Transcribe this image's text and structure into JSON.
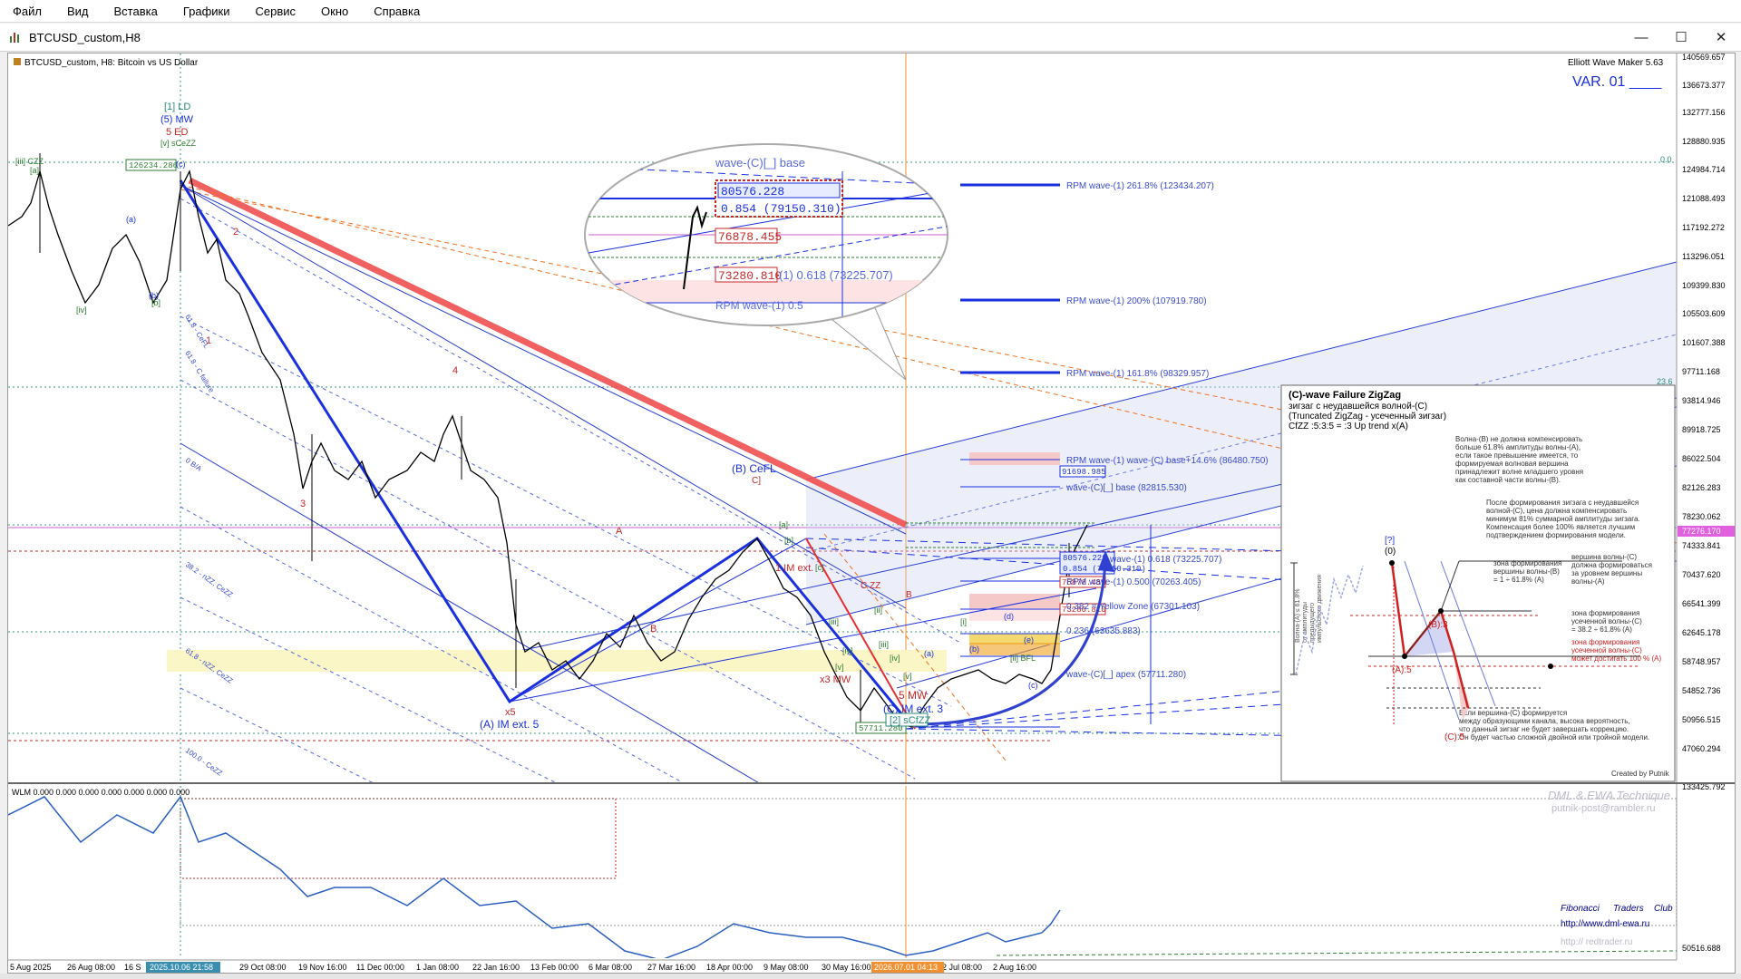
{
  "menu": [
    "Файл",
    "Вид",
    "Вставка",
    "Графики",
    "Сервис",
    "Окно",
    "Справка"
  ],
  "window": {
    "title": "BTCUSD_custom,H8",
    "minimize": "—",
    "maximize": "☐",
    "close": "✕"
  },
  "chart": {
    "symbol_label": "BTCUSD_custom, H8:  Bitcoin vs US Dollar",
    "indicator_name": "Elliott Wave Maker 5.63",
    "variant": "VAR. 01 ____",
    "current_price": "77276.170",
    "zero_label_top": "0.0",
    "level_236": "23.6"
  },
  "price_axis": [
    "140569.657",
    "136673.377",
    "132777.156",
    "128880.935",
    "124984.714",
    "121088.493",
    "117192.272",
    "113296.051",
    "109399.830",
    "105503.609",
    "101607.388",
    "97711.168",
    "93814.946",
    "89918.725",
    "86022.504",
    "82126.283",
    "78230.062",
    "74333.841",
    "70437.620",
    "66541.399",
    "62645.178",
    "58748.957",
    "54852.736",
    "50956.515",
    "47060.294",
    "133425.792",
    "50516.688"
  ],
  "time_axis": [
    "5 Aug 2025",
    "26 Aug 08:00",
    "16 S",
    "2025.10.06 21:58",
    "29 Oct 08:00",
    "19 Nov 16:00",
    "11 Dec 00:00",
    "1 Jan 08:00",
    "22 Jan 16:00",
    "13 Feb 00:00",
    "6 Mar 08:00",
    "27 Mar 16:00",
    "18 Apr 00:00",
    "9 May 08:00",
    "30 May 16:00",
    "2026.07.01 04:13",
    "2 Jul 08:00",
    "2 Aug 16:00"
  ],
  "wave_labels": {
    "top": [
      "[1] LD",
      "(5) MW",
      "5 ED",
      "[v] sCeZZ",
      "[iii] CZZ",
      "[a]",
      "[b]",
      "[iv]",
      "(a)",
      "(b)",
      "(c)"
    ],
    "lower": [
      "1",
      "2",
      "3",
      "4",
      "x5",
      "(A) IM ext. 5",
      "A",
      "B",
      "(B) CeFL",
      "C]",
      "1 IM ext.",
      "x3 MW",
      "5 MW",
      "(C) IM ext. 3",
      "[2] sCfZZ",
      "[ii] BFL",
      "[v]",
      "[iv]",
      "[iii]",
      "[c]",
      "[b]",
      "[a]",
      "[v]",
      "[iv]",
      "[iii]",
      "[ii]",
      "[i]",
      "(d)",
      "(e)",
      "(a)",
      "(b)",
      "(c)",
      "C ZZ",
      "B"
    ],
    "fib_side": [
      "61.8 - CeFL",
      "61.8 - C failure",
      "0 B/A",
      "38.2 - nZZ, CeZZ",
      "61.8 - nZZ, CeZZ",
      "100.0 - CeZZ"
    ]
  },
  "boxes": {
    "b1": "126234.286",
    "b2": "57711.280",
    "b3": "91698.985",
    "b4": "80576.228",
    "b5": "0.854 (79150.310)",
    "b6": "76878.455",
    "b7": "73280.810"
  },
  "rpm_lines": [
    "RPM wave-(1) 261.8% (123434.207)",
    "RPM wave-(1) 200% (107919.780)",
    "RPM wave-(1) 161.8% (98329.957)",
    "RPM wave-(1) wave-(C) base+14.6% (86480.750)",
    "wave-(C)[_] base (82815.530)",
    "wave-(1) 0.618 (73225.707)",
    "RPM wave-(1) 0.500 (70263.405)",
    "0.382 = Yellow Zone (67301.103)",
    "0.236 (63635.883)",
    "wave-(C)[_] apex (57711.280)"
  ],
  "zoom_bubble": {
    "l1": "wave-(C)[_] base",
    "l2": "80576.228",
    "l3": "0.854 (79150.310)",
    "l4": "76878.455",
    "l5": "73280.810",
    "l6": "(1) 0.618 (73225.707)",
    "l7": "RPM wave-(1) 0.5"
  },
  "info_panel": {
    "title": "(C)-wave Failure ZigZag",
    "sub1": "зигзаг с неудавшейся волной-(C)",
    "sub2": "(Truncated ZigZag - усеченный зигзаг)",
    "sub3": "CfZZ :5:3:5 = :3 Up trend x(A)",
    "p1": [
      "Волна-(B) не должна компенсировать",
      "больше 61.8% амплитуды волны-(A),",
      "если такое превышение имеется, то",
      "формируемая волновая вершина",
      "принадлежит волне младшего уровня",
      "как составной части волны-(B)."
    ],
    "p2": [
      "После формирования зигзага с неудавшейся",
      "волной-(C), цена должна компенсировать",
      "минимум 81% суммарной амплитуды зигзага.",
      "Компенсация более 100% является лучшим",
      "подтверждением формирования модели."
    ],
    "p3": [
      "зона формирования",
      "вершины волны-(B)",
      "= 1 ÷ 61.8% (A)"
    ],
    "p4": [
      "вершина волны-(C)",
      "должна формироваться",
      "за уровнем вершины",
      "волны-(A)"
    ],
    "p5": [
      "зона формирования",
      "усеченной волны-(C)",
      "= 38.2 ÷ 61.8% (A)"
    ],
    "p6": [
      "зона формирования",
      "усеченной волны-(C)",
      "может достигать 100 % (A)"
    ],
    "p7": [
      "Если вершина-(C) формируется",
      "между образующими канала, высока вероятность,",
      "что данный зигзаг не будет завершать коррекцию.",
      "Он будет частью сложной двойной или тройной модели."
    ],
    "vert": [
      "Волна-(A) ≤ 61.8%",
      "от амплитуды",
      "предыдущего",
      "импульсного движения"
    ],
    "lbl_q": "[?]",
    "lbl_0": "(0)",
    "lbl_a": "(A):5",
    "lbl_b": "(B):3",
    "lbl_c": "(C):5",
    "created": "Created by Putnik"
  },
  "subwindow": {
    "label": "WLM 0.000 0.000 0.000 0.000 0.000 0.000 0.000",
    "logo1": "DML & EWA Technique",
    "logo2": "putnik-post@rambler.ru",
    "club": [
      "Fibonacci",
      "Traders",
      "Club"
    ],
    "url1": "http://www.dml-ewa.ru",
    "url2": "http:// redtrader.ru"
  }
}
